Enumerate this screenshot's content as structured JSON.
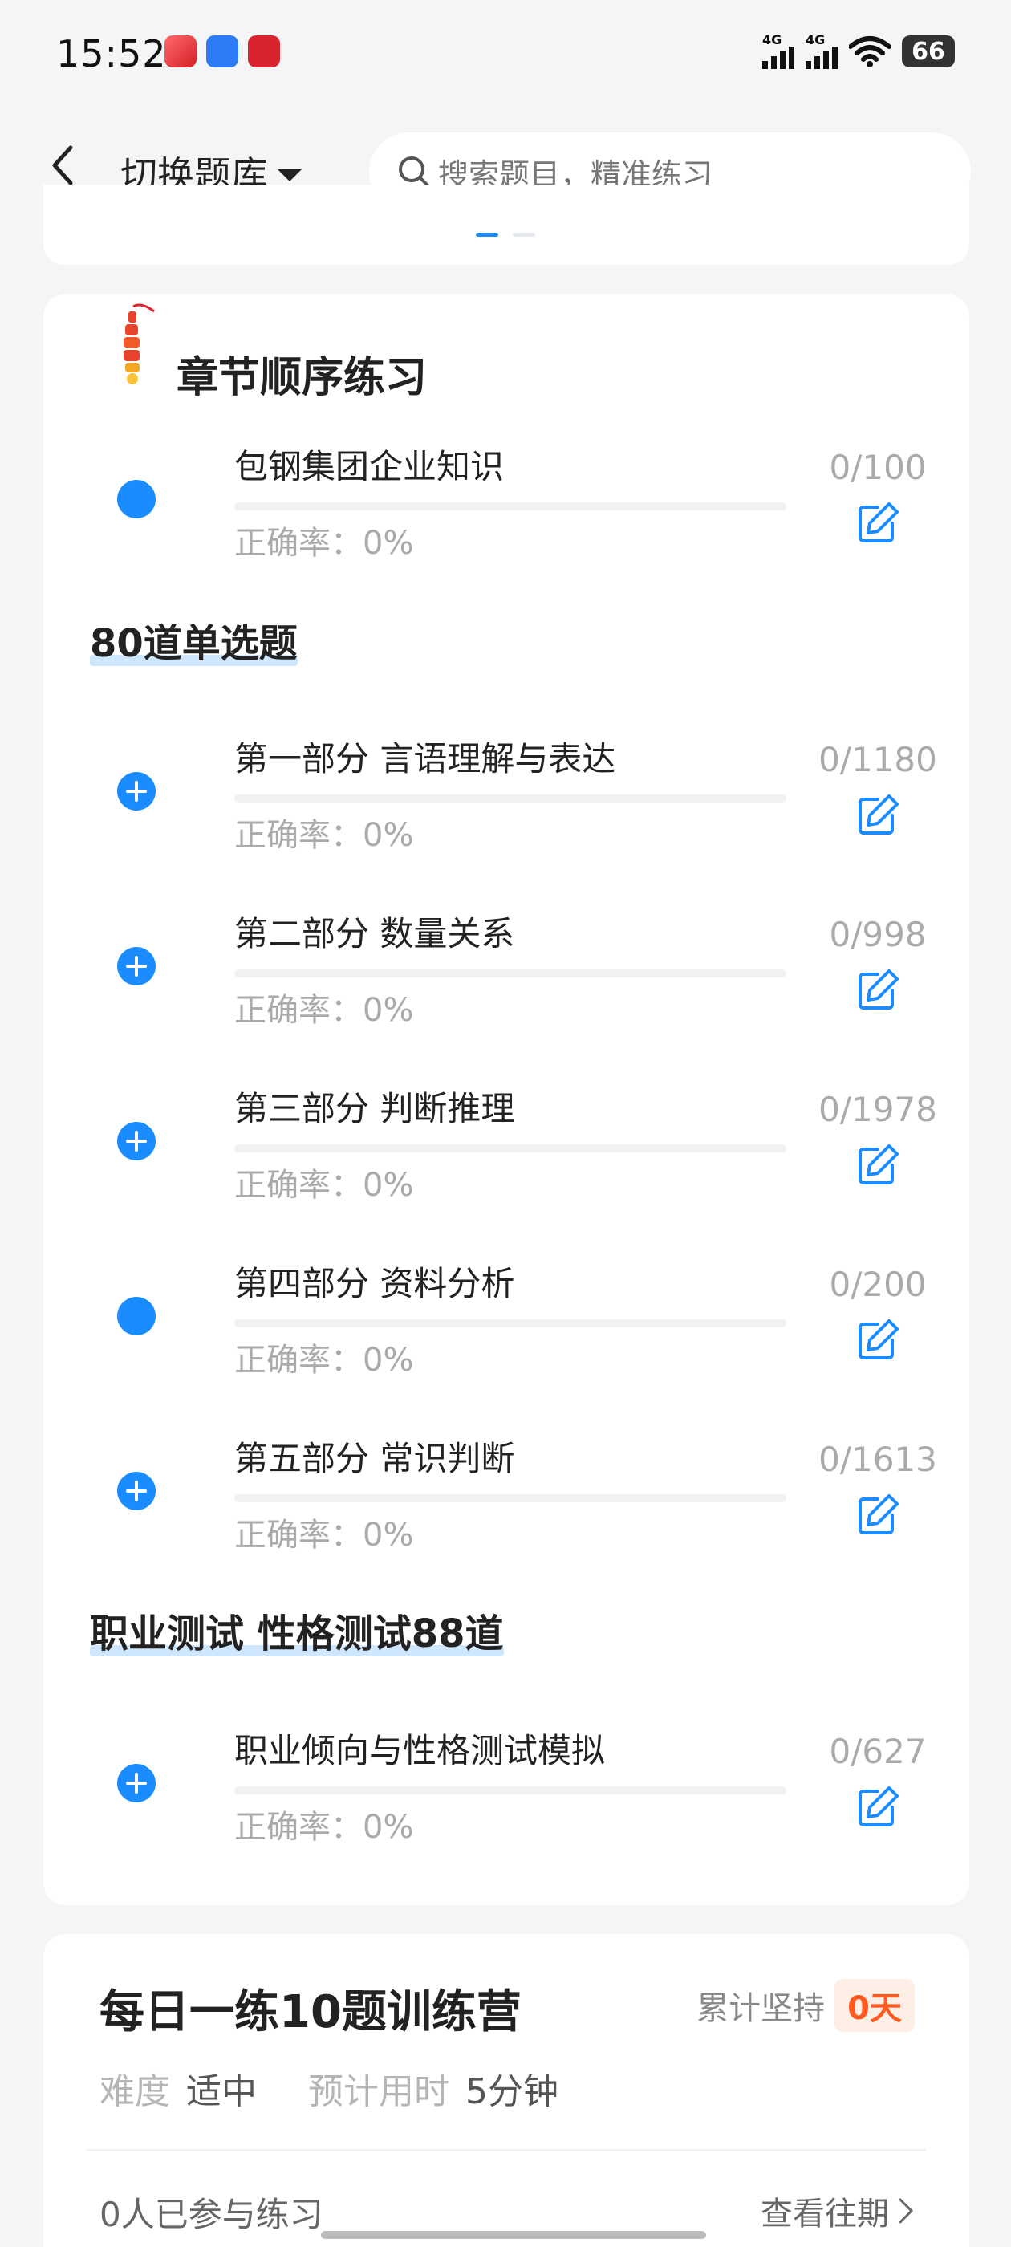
{
  "status_bar": {
    "time": "15:52",
    "signal1": "4G",
    "signal2": "4G",
    "battery": "66"
  },
  "nav": {
    "title": "切换题库",
    "search_placeholder": "搜索题目，精准练习"
  },
  "section": {
    "title": "章节顺序练习"
  },
  "top_items": [
    {
      "name": "包钢集团企业知识",
      "accuracy": "正确率：0%",
      "count": "0/100",
      "bullet": "dot",
      "progress": 0
    }
  ],
  "groups": [
    {
      "title": "80道单选题",
      "items": [
        {
          "name": "第一部分 言语理解与表达",
          "accuracy": "正确率：0%",
          "count": "0/1180",
          "bullet": "plus",
          "progress": 0
        },
        {
          "name": "第二部分 数量关系",
          "accuracy": "正确率：0%",
          "count": "0/998",
          "bullet": "plus",
          "progress": 0
        },
        {
          "name": "第三部分 判断推理",
          "accuracy": "正确率：0%",
          "count": "0/1978",
          "bullet": "plus",
          "progress": 0
        },
        {
          "name": "第四部分 资料分析",
          "accuracy": "正确率：0%",
          "count": "0/200",
          "bullet": "dot",
          "progress": 0
        },
        {
          "name": "第五部分 常识判断",
          "accuracy": "正确率：0%",
          "count": "0/1613",
          "bullet": "plus",
          "progress": 0
        }
      ]
    },
    {
      "title": "职业测试 性格测试88道",
      "items": [
        {
          "name": "职业倾向与性格测试模拟",
          "accuracy": "正确率：0%",
          "count": "0/627",
          "bullet": "plus",
          "progress": 0
        }
      ]
    }
  ],
  "daily": {
    "title": "每日一练10题训练营",
    "streak_label": "累计坚持",
    "streak_value": "0天",
    "difficulty_label": "难度",
    "difficulty_value": "适中",
    "time_label": "预计用时",
    "time_value": "5分钟",
    "participants": "0人已参与练习",
    "history_link": "查看往期"
  },
  "colors": {
    "accent": "#1a8cff",
    "streak": "#ff5a1f",
    "muted": "#aaaaaa"
  }
}
